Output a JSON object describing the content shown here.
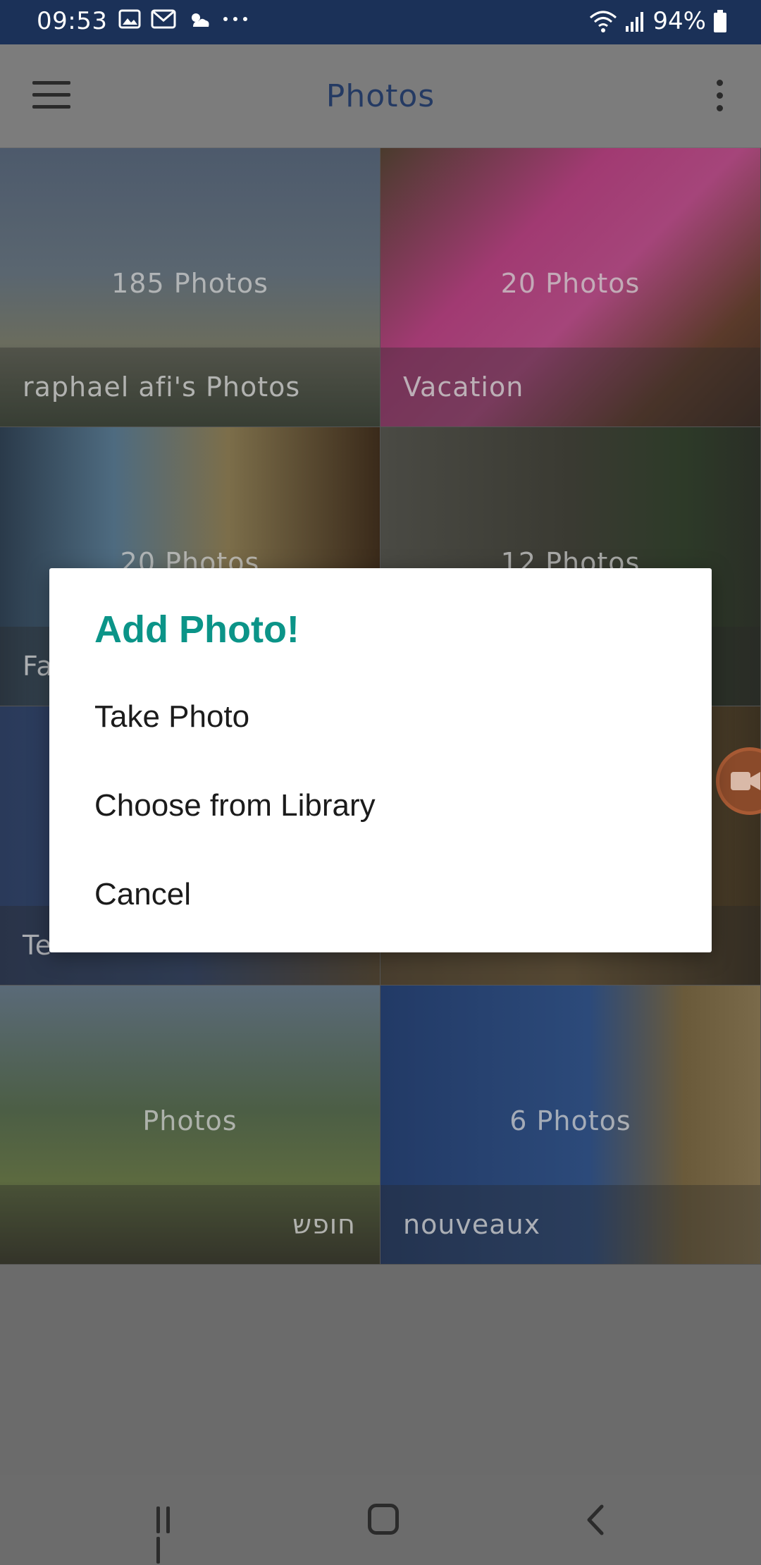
{
  "status_bar": {
    "time": "09:53",
    "battery": "94%",
    "left_icons": [
      "image-icon",
      "gmail-icon",
      "weather-icon",
      "more-dots-icon"
    ],
    "right_icons": [
      "wifi-icon",
      "signal-icon",
      "battery-icon"
    ]
  },
  "app_bar": {
    "title": "Photos",
    "menu_icon": "hamburger-menu-icon",
    "more_icon": "more-vertical-icon"
  },
  "albums": [
    {
      "name": "raphael afi's Photos",
      "count": "185 Photos"
    },
    {
      "name": "Vacation",
      "count": "20 Photos"
    },
    {
      "name": "Fa",
      "count": "20 Photos"
    },
    {
      "name": "",
      "count": "12 Photos"
    },
    {
      "name": "Te",
      "count": ""
    },
    {
      "name": "",
      "count": ""
    },
    {
      "name": "חופש",
      "count": "Photos"
    },
    {
      "name": "nouveaux",
      "count": "6 Photos"
    }
  ],
  "dialog": {
    "title": "Add Photo!",
    "options": [
      "Take Photo",
      "Choose from Library",
      "Cancel"
    ]
  },
  "colors": {
    "status_bar": "#1b3158",
    "dialog_title": "#0b9488",
    "app_title": "#243a63"
  },
  "nav_bar": {
    "icons": [
      "recent-apps-icon",
      "home-icon",
      "back-icon"
    ]
  }
}
